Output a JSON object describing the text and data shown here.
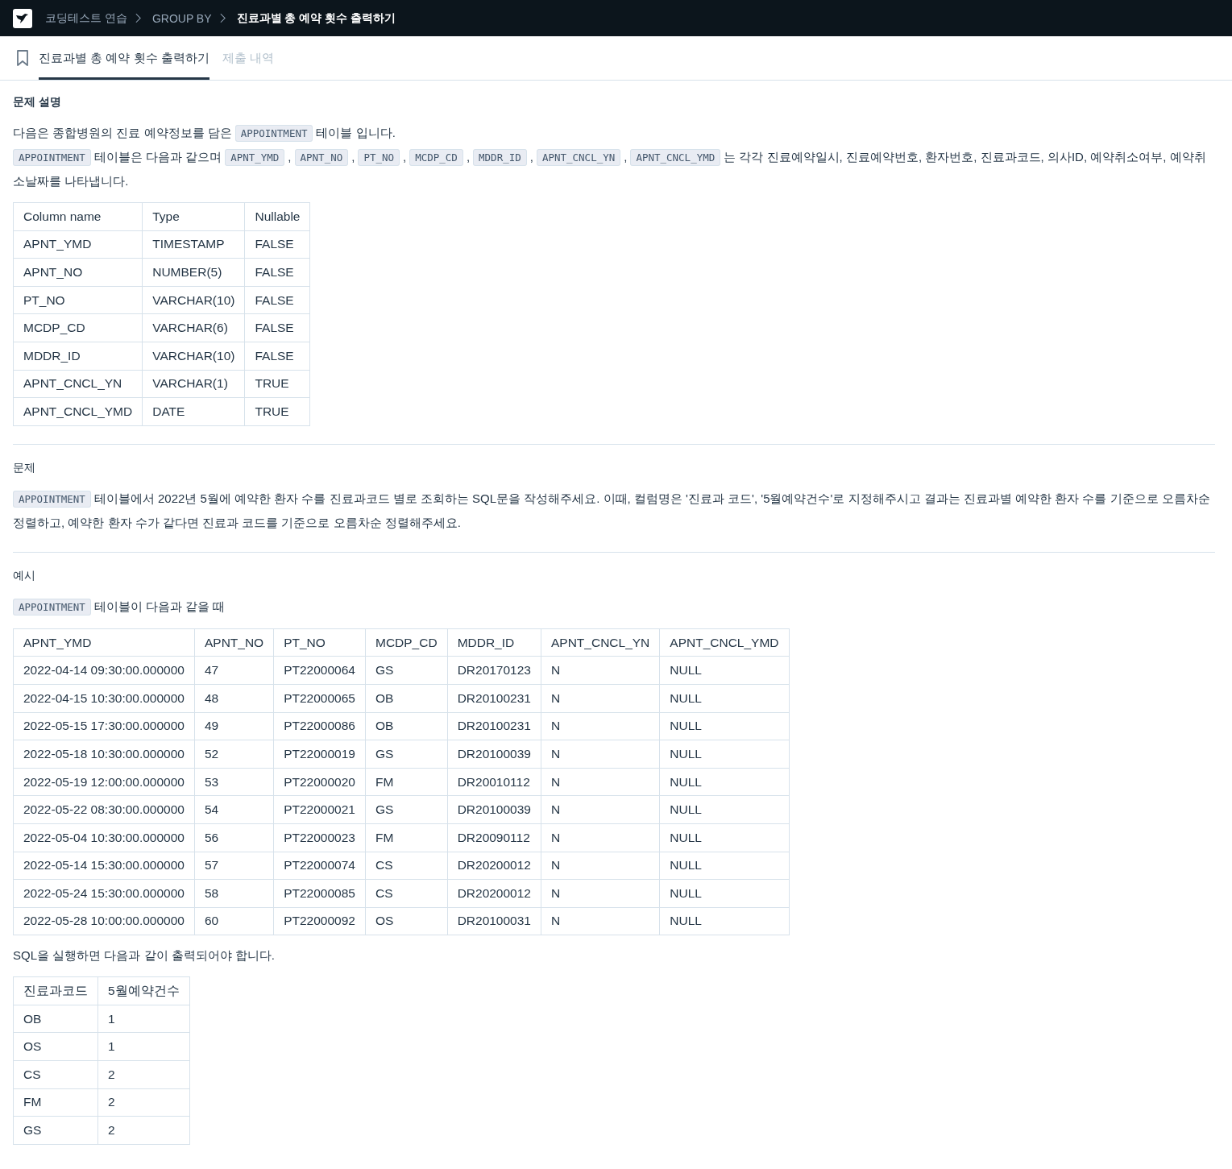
{
  "breadcrumb": [
    {
      "label": "코딩테스트 연습",
      "current": false
    },
    {
      "label": "GROUP BY",
      "current": false
    },
    {
      "label": "진료과별 총 예약 횟수 출력하기",
      "current": true
    }
  ],
  "tabs": [
    {
      "label": "진료과별 총 예약 횟수 출력하기",
      "selected": true
    },
    {
      "label": "제출 내역",
      "selected": false
    }
  ],
  "sections": [
    {
      "heading": "문제 설명",
      "heading_bold": true,
      "blocks": [
        {
          "kind": "para",
          "segments": [
            {
              "kind": "text",
              "text": "다음은 종합병원의 진료 예약정보를 담은"
            },
            {
              "kind": "code",
              "text": "APPOINTMENT"
            },
            {
              "kind": "text",
              "text": "테이블 입니다."
            }
          ]
        },
        {
          "kind": "para",
          "segments": [
            {
              "kind": "code",
              "text": "APPOINTMENT"
            },
            {
              "kind": "text",
              "text": "테이블은 다음과 같으며"
            },
            {
              "kind": "code",
              "text": "APNT_YMD"
            },
            {
              "kind": "text",
              "text": ","
            },
            {
              "kind": "code",
              "text": "APNT_NO"
            },
            {
              "kind": "text",
              "text": ","
            },
            {
              "kind": "code",
              "text": "PT_NO"
            },
            {
              "kind": "text",
              "text": ","
            },
            {
              "kind": "code",
              "text": "MCDP_CD"
            },
            {
              "kind": "text",
              "text": ","
            },
            {
              "kind": "code",
              "text": "MDDR_ID"
            },
            {
              "kind": "text",
              "text": ","
            },
            {
              "kind": "code",
              "text": "APNT_CNCL_YN"
            },
            {
              "kind": "text",
              "text": ","
            },
            {
              "kind": "code",
              "text": "APNT_CNCL_YMD"
            },
            {
              "kind": "text",
              "text": "는 각각 진료예약일시, 진료예약번호, 환자번호, 진료과코드, 의사ID, 예약취소여부, 예약취소날짜를 나타냅니다."
            }
          ]
        },
        {
          "kind": "table",
          "columns": [
            "Column name",
            "Type",
            "Nullable"
          ],
          "rows": [
            [
              "APNT_YMD",
              "TIMESTAMP",
              "FALSE"
            ],
            [
              "APNT_NO",
              "NUMBER(5)",
              "FALSE"
            ],
            [
              "PT_NO",
              "VARCHAR(10)",
              "FALSE"
            ],
            [
              "MCDP_CD",
              "VARCHAR(6)",
              "FALSE"
            ],
            [
              "MDDR_ID",
              "VARCHAR(10)",
              "FALSE"
            ],
            [
              "APNT_CNCL_YN",
              "VARCHAR(1)",
              "TRUE"
            ],
            [
              "APNT_CNCL_YMD",
              "DATE",
              "TRUE"
            ]
          ]
        }
      ]
    },
    {
      "heading": "문제",
      "heading_bold": false,
      "blocks": [
        {
          "kind": "para",
          "segments": [
            {
              "kind": "code",
              "text": "APPOINTMENT"
            },
            {
              "kind": "text",
              "text": "테이블에서 2022년 5월에 예약한 환자 수를 진료과코드 별로 조회하는 SQL문을 작성해주세요. 이때, 컬럼명은 '진료과 코드', '5월예약건수'로 지정해주시고 결과는 진료과별 예약한 환자 수를 기준으로 오름차순 정렬하고, 예약한 환자 수가 같다면 진료과 코드를 기준으로 오름차순 정렬해주세요."
            }
          ]
        }
      ]
    },
    {
      "heading": "예시",
      "heading_bold": false,
      "blocks": [
        {
          "kind": "para",
          "segments": [
            {
              "kind": "code",
              "text": "APPOINTMENT"
            },
            {
              "kind": "text",
              "text": "테이블이 다음과 같을 때"
            }
          ]
        },
        {
          "kind": "table",
          "columns": [
            "APNT_YMD",
            "APNT_NO",
            "PT_NO",
            "MCDP_CD",
            "MDDR_ID",
            "APNT_CNCL_YN",
            "APNT_CNCL_YMD"
          ],
          "rows": [
            [
              "2022-04-14 09:30:00.000000",
              "47",
              "PT22000064",
              "GS",
              "DR20170123",
              "N",
              "NULL"
            ],
            [
              "2022-04-15 10:30:00.000000",
              "48",
              "PT22000065",
              "OB",
              "DR20100231",
              "N",
              "NULL"
            ],
            [
              "2022-05-15 17:30:00.000000",
              "49",
              "PT22000086",
              "OB",
              "DR20100231",
              "N",
              "NULL"
            ],
            [
              "2022-05-18 10:30:00.000000",
              "52",
              "PT22000019",
              "GS",
              "DR20100039",
              "N",
              "NULL"
            ],
            [
              "2022-05-19 12:00:00.000000",
              "53",
              "PT22000020",
              "FM",
              "DR20010112",
              "N",
              "NULL"
            ],
            [
              "2022-05-22 08:30:00.000000",
              "54",
              "PT22000021",
              "GS",
              "DR20100039",
              "N",
              "NULL"
            ],
            [
              "2022-05-04 10:30:00.000000",
              "56",
              "PT22000023",
              "FM",
              "DR20090112",
              "N",
              "NULL"
            ],
            [
              "2022-05-14 15:30:00.000000",
              "57",
              "PT22000074",
              "CS",
              "DR20200012",
              "N",
              "NULL"
            ],
            [
              "2022-05-24 15:30:00.000000",
              "58",
              "PT22000085",
              "CS",
              "DR20200012",
              "N",
              "NULL"
            ],
            [
              "2022-05-28 10:00:00.000000",
              "60",
              "PT22000092",
              "OS",
              "DR20100031",
              "N",
              "NULL"
            ]
          ]
        },
        {
          "kind": "para",
          "segments": [
            {
              "kind": "text",
              "text": "SQL을 실행하면 다음과 같이 출력되어야 합니다."
            }
          ]
        },
        {
          "kind": "table",
          "columns": [
            "진료과코드",
            "5월예약건수"
          ],
          "rows": [
            [
              "OB",
              "1"
            ],
            [
              "OS",
              "1"
            ],
            [
              "CS",
              "2"
            ],
            [
              "FM",
              "2"
            ],
            [
              "GS",
              "2"
            ]
          ]
        }
      ]
    }
  ]
}
